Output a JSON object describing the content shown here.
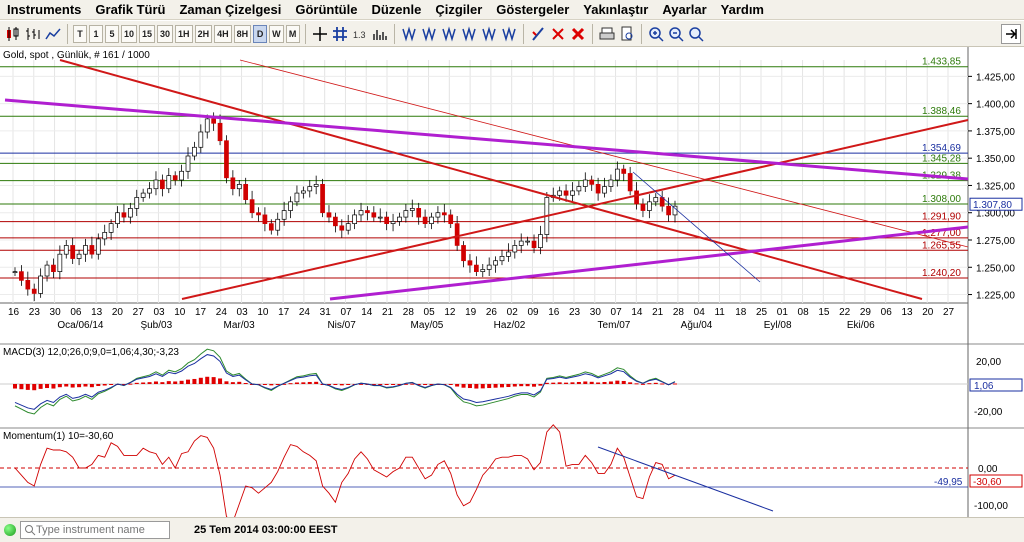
{
  "menu": [
    "Instruments",
    "Grafik Türü",
    "Zaman Çizelgesi",
    "Görüntüle",
    "Düzenle",
    "Çizgiler",
    "Göstergeler",
    "Yakınlaştır",
    "Ayarlar",
    "Yardım"
  ],
  "toolbar": {
    "timeframes": [
      "T",
      "1",
      "5",
      "10",
      "15",
      "30",
      "1H",
      "2H",
      "4H",
      "8H",
      "D",
      "W",
      "M"
    ],
    "active_timeframe": "D"
  },
  "chart": {
    "title": "Gold, spot , Günlük, # 161 / 1000",
    "price_labels": [
      "1.425,00",
      "1.400,00",
      "1.375,00",
      "1.350,00",
      "1.325,00",
      "1.300,00",
      "1.275,00",
      "1.250,00",
      "1.225,00"
    ],
    "level_tags": [
      {
        "text": "1.433,85",
        "color": "#2d7a0a"
      },
      {
        "text": "1.388,46",
        "color": "#2d7a0a"
      },
      {
        "text": "1.354,69",
        "color": "#1a2fa0"
      },
      {
        "text": "1.345,28",
        "color": "#2d7a0a"
      },
      {
        "text": "1.329,38",
        "color": "#2d7a0a"
      },
      {
        "text": "1.308,00",
        "color": "#2d7a0a"
      },
      {
        "text": "1.291,90",
        "color": "#b00000"
      },
      {
        "text": "1.277,00",
        "color": "#b00000"
      },
      {
        "text": "1.265,55",
        "color": "#b00000"
      },
      {
        "text": "1.240,20",
        "color": "#b00000"
      }
    ],
    "current_price": "1.307,80",
    "day_ticks": [
      "16",
      "23",
      "30",
      "06",
      "13",
      "20",
      "27",
      "03",
      "10",
      "17",
      "24",
      "03",
      "10",
      "17",
      "24",
      "31",
      "07",
      "14",
      "21",
      "28",
      "05",
      "12",
      "19",
      "26",
      "02",
      "09",
      "16",
      "23",
      "30",
      "07",
      "14",
      "21",
      "28",
      "04",
      "11",
      "18",
      "25",
      "01",
      "08",
      "15",
      "22",
      "29",
      "06",
      "13",
      "20",
      "27"
    ],
    "month_labels": [
      "Oca/06/14",
      "Şub/03",
      "Mar/03",
      "Nis/07",
      "May/05",
      "Haz/02",
      "Tem/07",
      "Ağu/04",
      "Eyl/08",
      "Eki/06"
    ],
    "chart_data": {
      "type": "candlestick",
      "instrument": "Gold, spot",
      "interval": "Günlük",
      "ylim": [
        1220,
        1440
      ],
      "close_approx": [
        1246,
        1238,
        1230,
        1226,
        1242,
        1252,
        1246,
        1262,
        1270,
        1258,
        1262,
        1270,
        1262,
        1276,
        1282,
        1290,
        1300,
        1296,
        1304,
        1314,
        1318,
        1322,
        1330,
        1322,
        1334,
        1330,
        1338,
        1352,
        1360,
        1374,
        1386,
        1382,
        1366,
        1332,
        1322,
        1326,
        1312,
        1300,
        1298,
        1290,
        1284,
        1294,
        1302,
        1310,
        1318,
        1320,
        1324,
        1326,
        1300,
        1296,
        1288,
        1284,
        1290,
        1298,
        1302,
        1300,
        1296,
        1296,
        1290,
        1292,
        1296,
        1302,
        1304,
        1296,
        1290,
        1296,
        1300,
        1298,
        1290,
        1270,
        1256,
        1252,
        1246,
        1248,
        1252,
        1256,
        1260,
        1264,
        1270,
        1274,
        1274,
        1268,
        1280,
        1314,
        1316,
        1320,
        1316,
        1320,
        1324,
        1330,
        1326,
        1318,
        1324,
        1330,
        1340,
        1336,
        1320,
        1308,
        1302,
        1310,
        1314,
        1306,
        1298,
        1306
      ]
    }
  },
  "macd": {
    "title": "MACD(3) 12,0;26,0;9,0=1,06;4,30;-3,23",
    "scale": [
      "20,00",
      "-20,00"
    ],
    "current": "1,06"
  },
  "momentum": {
    "title": "Momentum(1) 10=-30,60",
    "scale": [
      "0,00",
      "-100,00"
    ],
    "trend_value": "-49,95",
    "current": "-30,60"
  },
  "status": {
    "search_placeholder": "Type instrument name",
    "datetime": "25 Tem 2014 03:00:00 EEST"
  }
}
